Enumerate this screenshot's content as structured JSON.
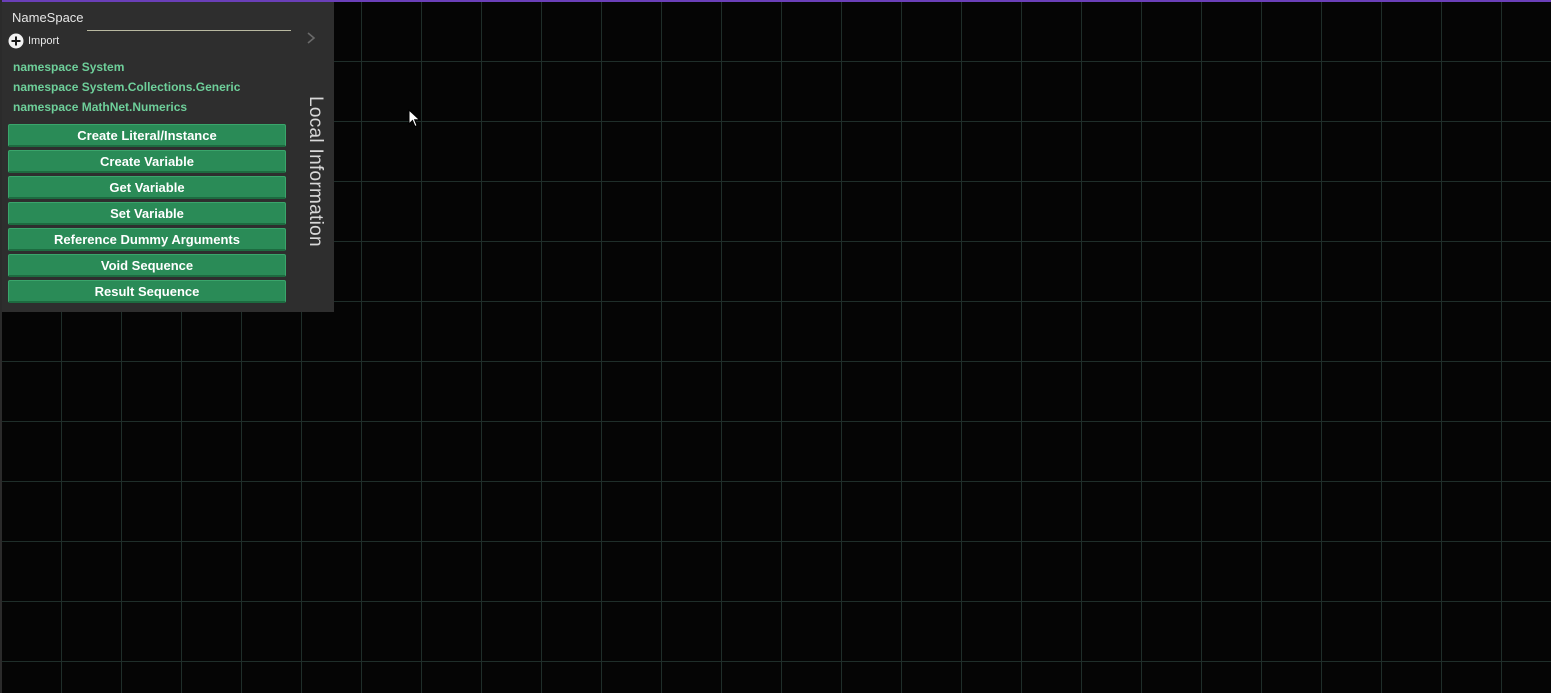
{
  "colors": {
    "accent_top": "#6a3fb8",
    "namespace_text": "#6ecf9a",
    "action_button": "#2a8b57",
    "panel_bg": "#2e2e2e",
    "canvas_bg": "#050505",
    "grid_line": "#1f2e2a"
  },
  "namespace_panel": {
    "header": "NameSpace",
    "search_value": "",
    "import_label": "Import",
    "import_icon": "plus-circle-icon",
    "namespaces": [
      "namespace System",
      "namespace System.Collections.Generic",
      "namespace MathNet.Numerics"
    ]
  },
  "actions": [
    "Create Literal/Instance",
    "Create Variable",
    "Get Variable",
    "Set Variable",
    "Reference Dummy Arguments",
    "Void Sequence",
    "Result Sequence"
  ],
  "side_tab": {
    "label": "Local Information",
    "arrow_icon": "chevron-right-icon"
  },
  "cursor_icon": "mouse-pointer-icon"
}
